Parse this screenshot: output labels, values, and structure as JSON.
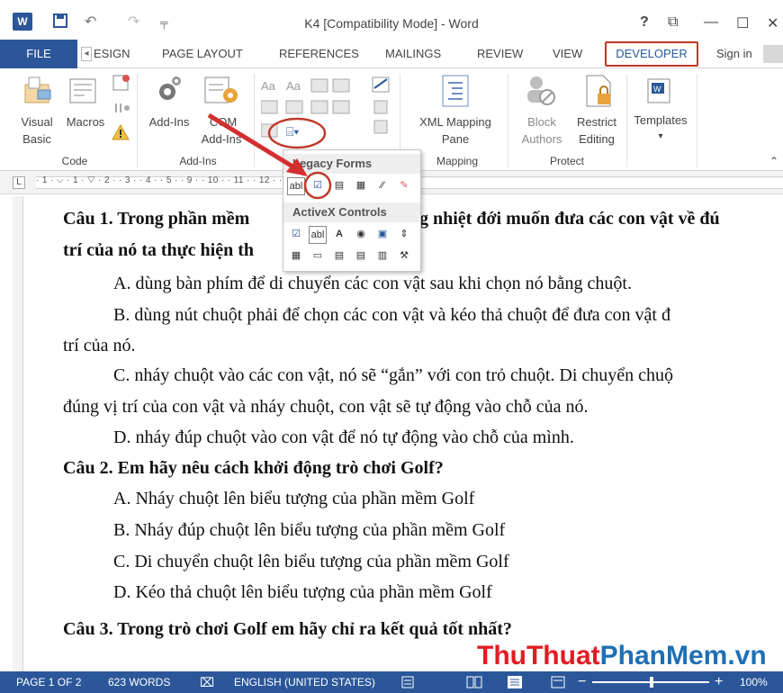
{
  "window": {
    "title": "K4 [Compatibility Mode] - Word",
    "help": "?",
    "restore": "⧉",
    "minimize": "—",
    "maximize": "☐",
    "close": "✕"
  },
  "qat": {
    "undo": "↶",
    "redo": "↷",
    "customize": "╤"
  },
  "tabs": {
    "file": "FILE",
    "scroll_left": "◂",
    "design": "ESIGN",
    "page_layout": "PAGE LAYOUT",
    "references": "REFERENCES",
    "mailings": "MAILINGS",
    "review": "REVIEW",
    "view": "VIEW",
    "developer": "DEVELOPER",
    "sign_in": "Sign in"
  },
  "ribbon": {
    "code": {
      "label": "Code",
      "visual_basic_1": "Visual",
      "visual_basic_2": "Basic",
      "macros": "Macros"
    },
    "addins": {
      "label": "Add-Ins",
      "addins": "Add-Ins",
      "com_1": "COM",
      "com_2": "Add-Ins"
    },
    "controls": {
      "legacy_button": "⌸▾"
    },
    "mapping": {
      "label": "Mapping",
      "xml_1": "XML Mapping",
      "xml_2": "Pane"
    },
    "protect": {
      "label": "Protect",
      "block_1": "Block",
      "block_2": "Authors",
      "restrict_1": "Restrict",
      "restrict_2": "Editing"
    },
    "templates": {
      "label": "Templates",
      "caret": "▾"
    }
  },
  "dropdown": {
    "legacy_header": "Legacy Forms",
    "activex_header": "ActiveX Controls",
    "legacy_items": [
      "abl",
      "☑",
      "▤",
      "▦",
      "⁄⁄",
      "✎"
    ],
    "activex_row1": [
      "☑",
      "abl",
      "A",
      "◉",
      "▣",
      "⇕"
    ],
    "activex_row2": [
      "▦",
      "▭",
      "▤",
      "▤",
      "▥",
      "⚒"
    ]
  },
  "ruler": {
    "tab_marker": "L",
    "numbers": "· 1 · ⌵ · 1 · ▽ · 2 · · 3 · · 4 · · 5 ·                · 9 · · 10 · · 11 · · 12 · · 13 · · 14 · · 15 · · 16 ·"
  },
  "document": {
    "lines": [
      {
        "text": "Câu 1. Trong phần mềm",
        "bold": true
      },
      {
        "text": "g nhiệt đới muốn đưa các con vật về đú",
        "bold": true
      },
      {
        "text": "trí của nó ta thực hiện th",
        "bold": true
      },
      {
        "text": "A. dùng bàn phím để di chuyển các con vật sau khi chọn nó bằng chuột.",
        "bold": false
      },
      {
        "text": "B. dùng nút chuột phải để chọn các con vật và kéo thả chuột để đưa con vật đ",
        "bold": false
      },
      {
        "text": "trí của nó.",
        "bold": false
      },
      {
        "text": "C. nháy chuột vào các con vật, nó sẽ “gắn” với con trỏ chuột. Di chuyển chuộ",
        "bold": false
      },
      {
        "text": "đúng vị trí của con vật và nháy chuột, con vật sẽ tự động vào chỗ của nó.",
        "bold": false
      },
      {
        "text": "D. nháy đúp chuột vào con vật để nó tự động vào chỗ của mình.",
        "bold": false
      },
      {
        "text": "Câu 2. Em hãy nêu cách khởi động trò chơi Golf?",
        "bold": true
      },
      {
        "text": "A. Nháy chuột lên biểu tượng của phần mềm Golf",
        "bold": false
      },
      {
        "text": "B. Nháy đúp chuột lên biểu tượng của phần mềm Golf",
        "bold": false
      },
      {
        "text": "C. Di chuyển chuột lên biểu tượng của phần mềm Golf",
        "bold": false
      },
      {
        "text": "D. Kéo thả chuột lên biểu tượng của phần mềm Golf",
        "bold": false
      },
      {
        "text": "Câu 3. Trong trò chơi Golf em hãy chỉ ra kết quả tốt nhất?",
        "bold": true
      }
    ]
  },
  "watermark": {
    "part1": "Thu",
    "part2": "Thuat",
    "part3": "PhanMem",
    "part4": ".vn"
  },
  "status": {
    "page": "PAGE 1 OF 2",
    "words": "623 WORDS",
    "proof_icon": "⌧",
    "language": "ENGLISH (UNITED STATES)",
    "zoom_minus": "−",
    "zoom_plus": "+",
    "zoom": "100%"
  },
  "colors": {
    "accent": "#2b579a",
    "highlight": "#c0392b",
    "watermark_red": "#e31b23",
    "watermark_blue": "#1f6fb5"
  }
}
